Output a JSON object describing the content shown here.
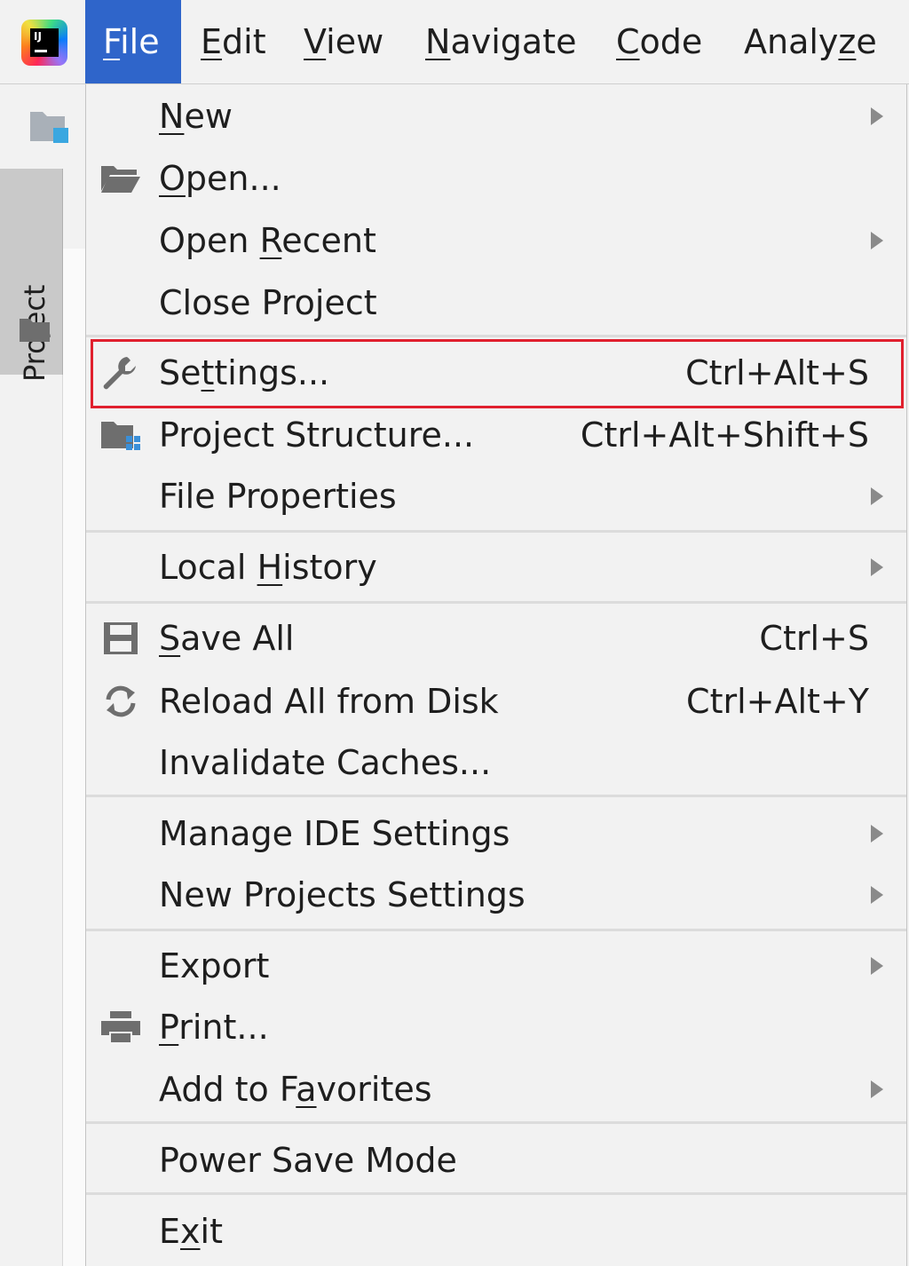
{
  "menubar": {
    "logo_text": "IJ",
    "menus": [
      {
        "label": "File",
        "mnemonic": "F",
        "rest": "ile",
        "active": true
      },
      {
        "label": "Edit",
        "mnemonic": "E",
        "rest": "dit",
        "active": false
      },
      {
        "label": "View",
        "mnemonic": "V",
        "rest": "iew",
        "active": false
      },
      {
        "label": "Navigate",
        "mnemonic": "N",
        "rest": "avigate",
        "active": false
      },
      {
        "label": "Code",
        "mnemonic": "C",
        "rest": "ode",
        "active": false
      },
      {
        "label": "Analyze",
        "pre": "Analy",
        "mnemonic": "z",
        "rest": "e",
        "active": false
      }
    ]
  },
  "toolwindow": {
    "project_tab_label": "Project"
  },
  "file_menu": {
    "items": [
      {
        "pre": "",
        "mn": "N",
        "post": "ew",
        "shortcut": "",
        "submenu": true,
        "icon": ""
      },
      {
        "pre": "",
        "mn": "O",
        "post": "pen...",
        "shortcut": "",
        "submenu": false,
        "icon": "open-folder-icon"
      },
      {
        "pre": "Open ",
        "mn": "R",
        "post": "ecent",
        "shortcut": "",
        "submenu": true,
        "icon": ""
      },
      {
        "pre": "Close Project",
        "mn": "",
        "post": "",
        "shortcut": "",
        "submenu": false,
        "icon": ""
      },
      {
        "pre": "Se",
        "mn": "t",
        "post": "tings...",
        "shortcut": "Ctrl+Alt+S",
        "submenu": false,
        "icon": "wrench-icon"
      },
      {
        "pre": "Project Structure...",
        "mn": "",
        "post": "",
        "shortcut": "Ctrl+Alt+Shift+S",
        "submenu": false,
        "icon": "project-structure-icon"
      },
      {
        "pre": "File Properties",
        "mn": "",
        "post": "",
        "shortcut": "",
        "submenu": true,
        "icon": ""
      },
      {
        "pre": "Local ",
        "mn": "H",
        "post": "istory",
        "shortcut": "",
        "submenu": true,
        "icon": ""
      },
      {
        "pre": "",
        "mn": "S",
        "post": "ave All",
        "shortcut": "Ctrl+S",
        "submenu": false,
        "icon": "save-icon"
      },
      {
        "pre": "Reload All from Disk",
        "mn": "",
        "post": "",
        "shortcut": "Ctrl+Alt+Y",
        "submenu": false,
        "icon": "reload-icon"
      },
      {
        "pre": "Invalidate Caches...",
        "mn": "",
        "post": "",
        "shortcut": "",
        "submenu": false,
        "icon": ""
      },
      {
        "pre": "Manage IDE Settings",
        "mn": "",
        "post": "",
        "shortcut": "",
        "submenu": true,
        "icon": ""
      },
      {
        "pre": "New Projects Settings",
        "mn": "",
        "post": "",
        "shortcut": "",
        "submenu": true,
        "icon": ""
      },
      {
        "pre": "Export",
        "mn": "",
        "post": "",
        "shortcut": "",
        "submenu": true,
        "icon": ""
      },
      {
        "pre": "",
        "mn": "P",
        "post": "rint...",
        "shortcut": "",
        "submenu": false,
        "icon": "print-icon"
      },
      {
        "pre": "Add to F",
        "mn": "a",
        "post": "vorites",
        "shortcut": "",
        "submenu": true,
        "icon": ""
      },
      {
        "pre": "Power Save Mode",
        "mn": "",
        "post": "",
        "shortcut": "",
        "submenu": false,
        "icon": ""
      },
      {
        "pre": "E",
        "mn": "x",
        "post": "it",
        "shortcut": "",
        "submenu": false,
        "icon": ""
      }
    ]
  },
  "colors": {
    "active_menu": "#2f65ca",
    "highlight_border": "#e0202e",
    "submenu_arrow": "#8a8a8a"
  }
}
